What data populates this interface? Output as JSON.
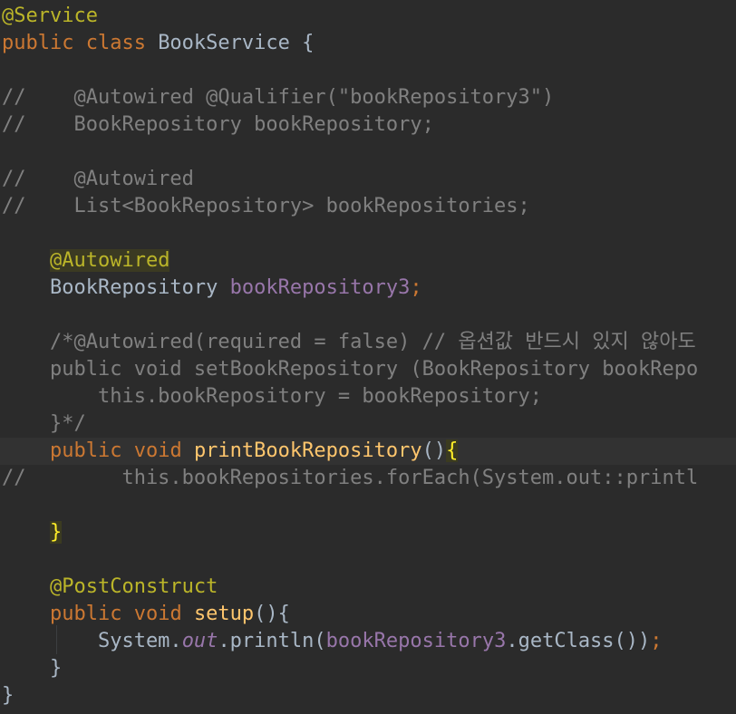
{
  "editor": {
    "lines": [
      {
        "tokens": [
          {
            "t": "@Service",
            "c": "ann"
          }
        ]
      },
      {
        "tokens": [
          {
            "t": "public class ",
            "c": "kw"
          },
          {
            "t": "BookService ",
            "c": "cls"
          },
          {
            "t": "{",
            "c": "punc"
          }
        ]
      },
      {
        "tokens": []
      },
      {
        "tokens": [
          {
            "t": "//    @Autowired @Qualifier(\"bookRepository3\")",
            "c": "cmt"
          }
        ]
      },
      {
        "tokens": [
          {
            "t": "//    BookRepository bookRepository;",
            "c": "cmt"
          }
        ]
      },
      {
        "tokens": []
      },
      {
        "tokens": [
          {
            "t": "//    @Autowired",
            "c": "cmt"
          }
        ]
      },
      {
        "tokens": [
          {
            "t": "//    List<BookRepository> bookRepositories;",
            "c": "cmt"
          }
        ]
      },
      {
        "tokens": []
      },
      {
        "tokens": [
          {
            "t": "    ",
            "c": "punc"
          },
          {
            "t": "@Autowired",
            "c": "hl-ann"
          }
        ]
      },
      {
        "tokens": [
          {
            "t": "    BookRepository ",
            "c": "cls"
          },
          {
            "t": "bookRepository3",
            "c": "field"
          },
          {
            "t": ";",
            "c": "kw"
          }
        ]
      },
      {
        "tokens": []
      },
      {
        "tokens": [
          {
            "t": "    /*@Autowired(required = false) // 옵션값 반드시 있지 않아도 ",
            "c": "cmt"
          }
        ]
      },
      {
        "tokens": [
          {
            "t": "    public void setBookRepository (BookRepository bookRepo",
            "c": "cmt"
          }
        ]
      },
      {
        "tokens": [
          {
            "t": "        this.bookRepository = bookRepository;",
            "c": "cmt"
          }
        ]
      },
      {
        "tokens": [
          {
            "t": "    }*/",
            "c": "cmt"
          }
        ]
      },
      {
        "tokens": [
          {
            "t": "    ",
            "c": "punc"
          },
          {
            "t": "public ",
            "c": "kw"
          },
          {
            "t": "void ",
            "c": "kw"
          },
          {
            "t": "printBookRepository",
            "c": "method"
          },
          {
            "t": "()",
            "c": "punc"
          },
          {
            "t": "{",
            "c": "hl-brace"
          }
        ],
        "current": true
      },
      {
        "tokens": [
          {
            "t": "//        this.bookRepositories.forEach(System.out::printl",
            "c": "cmt"
          }
        ]
      },
      {
        "tokens": []
      },
      {
        "tokens": [
          {
            "t": "    ",
            "c": "punc"
          },
          {
            "t": "}",
            "c": "hl-brace"
          }
        ]
      },
      {
        "tokens": []
      },
      {
        "tokens": [
          {
            "t": "    @PostConstruct",
            "c": "ann"
          }
        ]
      },
      {
        "tokens": [
          {
            "t": "    public ",
            "c": "kw"
          },
          {
            "t": "void ",
            "c": "kw"
          },
          {
            "t": "setup",
            "c": "method"
          },
          {
            "t": "(){",
            "c": "punc"
          }
        ]
      },
      {
        "tokens": [
          {
            "t": "        System.",
            "c": "cls"
          },
          {
            "t": "out",
            "c": "static"
          },
          {
            "t": ".println(",
            "c": "cls"
          },
          {
            "t": "bookRepository3",
            "c": "field"
          },
          {
            "t": ".getClass())",
            "c": "cls"
          },
          {
            "t": ";",
            "c": "kw"
          }
        ]
      },
      {
        "tokens": [
          {
            "t": "    }",
            "c": "punc"
          }
        ]
      },
      {
        "tokens": [
          {
            "t": "}",
            "c": "punc"
          }
        ]
      }
    ]
  }
}
